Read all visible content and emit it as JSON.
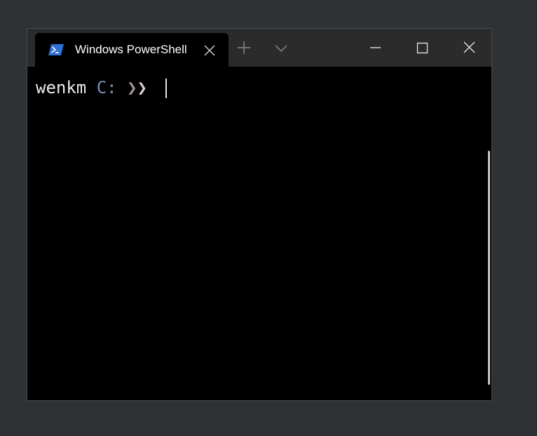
{
  "tab": {
    "title": "Windows PowerShell",
    "icon": "powershell-icon"
  },
  "titlebar": {
    "new_tab_icon": "plus-icon",
    "dropdown_icon": "chevron-down-icon",
    "minimize_icon": "minimize-icon",
    "maximize_icon": "maximize-icon",
    "close_icon": "close-icon"
  },
  "terminal": {
    "prompt_user": "wenkm",
    "prompt_drive": "C:",
    "prompt_arrow_a": "❯",
    "prompt_arrow_b": "❯"
  },
  "colors": {
    "background": "#2f3234",
    "titlebar": "#2b2b2b",
    "terminal_bg": "#000000",
    "user_text": "#ececec",
    "drive_text": "#7d8fb8",
    "powershell_blue": "#2f6fd6"
  }
}
